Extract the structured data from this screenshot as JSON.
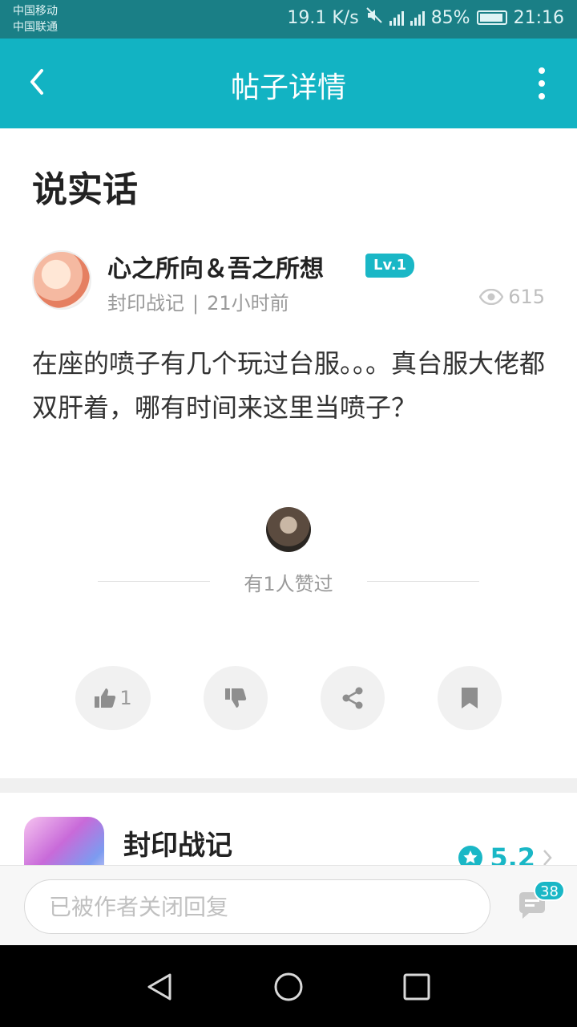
{
  "status_bar": {
    "carrier1": "中国移动",
    "carrier2": "中国联通",
    "net_speed": "19.1 K/s",
    "battery": "85%",
    "time": "21:16"
  },
  "app_bar": {
    "title": "帖子详情"
  },
  "post": {
    "title": "说实话",
    "author": "心之所向＆吾之所想",
    "level": "Lv.1",
    "source": "封印战记",
    "separator": "|",
    "time_ago": "21小时前",
    "views": "615",
    "body": "在座的喷子有几个玩过台服。。。真台服大佬都双肝着，哪有时间来这里当喷子？"
  },
  "likes": {
    "summary": "有1人赞过"
  },
  "actions": {
    "like_count": "1"
  },
  "game": {
    "name": "封印战记",
    "rating": "5.2"
  },
  "reply": {
    "placeholder": "已被作者关闭回复",
    "comment_count": "38"
  },
  "colors": {
    "accent": "#12b3c3",
    "status_bar": "#1a7f86",
    "badge": "#1ab7c6"
  }
}
